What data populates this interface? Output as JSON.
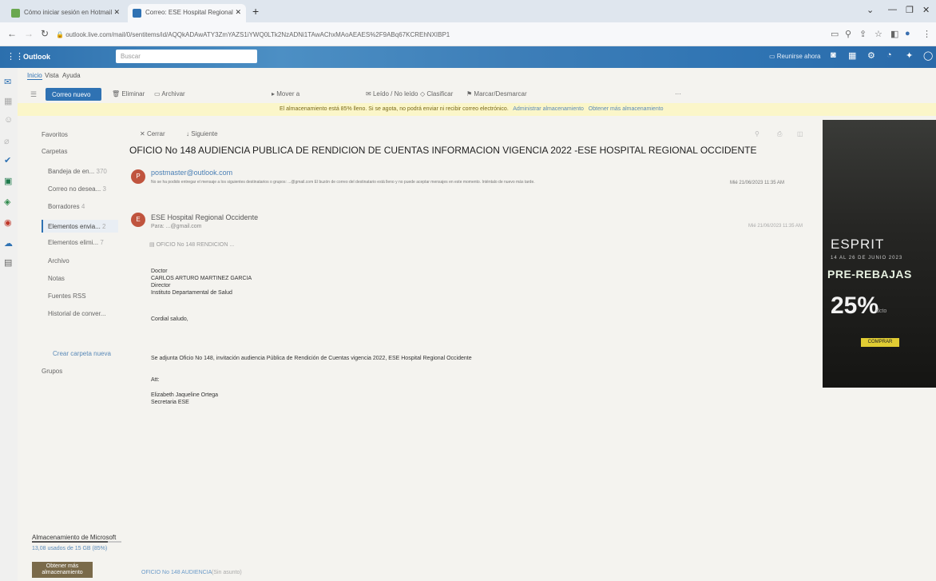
{
  "browser": {
    "tabs": [
      {
        "label": "Cómo iniciar sesión en Hotmail"
      },
      {
        "label": "Correo: ESE Hospital Regional"
      }
    ],
    "new_tab": "+",
    "url": "outlook.live.com/mail/0/sentitems/id/AQQkADAwATY3ZmYAZS1iYWQ0LTk2NzADNi1TAwAChxMAoAEAES%2F9ABq67KCREhNXIBP1"
  },
  "outlook": {
    "brand": "Outlook",
    "search_placeholder": "Buscar",
    "meet_now": "Reunirse ahora"
  },
  "menu_tabs": [
    "Inicio",
    "Vista",
    "Ayuda"
  ],
  "commands": {
    "new_mail": "Correo nuevo",
    "delete": "Eliminar",
    "archive": "Archivar",
    "move": "Mover a",
    "read_unread": "Leído / No leído",
    "categorize": "Clasificar",
    "flag": "Marcar/Desmarcar"
  },
  "warning": {
    "text": "El almacenamiento está 85% lleno. Si se agota, no podrá enviar ni recibir correo electrónico.",
    "link1": "Administrar almacenamiento",
    "link2": "Obtener más almacenamiento"
  },
  "folders": {
    "favorites": "Favoritos",
    "folders_header": "Carpetas",
    "items": [
      {
        "label": "Bandeja de en...",
        "count": "370"
      },
      {
        "label": "Correo no desea...",
        "count": "3"
      },
      {
        "label": "Borradores",
        "count": "4"
      },
      {
        "label": "Elementos envia...",
        "count": "2"
      },
      {
        "label": "Elementos elimi...",
        "count": "7"
      },
      {
        "label": "Archivo",
        "count": ""
      },
      {
        "label": "Notas",
        "count": ""
      },
      {
        "label": "Fuentes RSS",
        "count": ""
      },
      {
        "label": "Historial de conver...",
        "count": ""
      }
    ],
    "new_folder": "Crear carpeta nueva",
    "groups": "Grupos"
  },
  "reading": {
    "close": "Cerrar",
    "next": "Siguiente",
    "subject": "OFICIO No 148 AUDIENCIA PUBLICA DE RENDICION DE CUENTAS INFORMACION VIGENCIA 2022 -ESE HOSPITAL REGIONAL OCCIDENTE",
    "ndr": {
      "avatar": "P",
      "from": "postmaster@outlook.com",
      "preview": "No se ha podido entregar el mensaje a los siguientes destinatarios o grupos: ...@gmail.com El buzón de correo del destinatario está lleno y no puede aceptar mensajes en este momento. Inténtalo de nuevo más tarde.",
      "date": "Mié 21/06/2023 11:35 AM"
    },
    "message": {
      "avatar": "E",
      "from": "ESE Hospital Regional Occidente",
      "to": "Para: ...@gmail.com",
      "date": "Mié 21/06/2023 11:35 AM",
      "attachment": "OFICIO No 148 RENDICION ...",
      "body": [
        "Doctor",
        "CARLOS ARTURO MARTINEZ GARCIA",
        "Director",
        "Instituto Departamental de Salud",
        "Cordial saludo,",
        "Se adjunta Oficio No 148, invitación audiencia Pública de Rendición de Cuentas vigencia 2022, ESE Hospital Regional Occidente",
        "Att:",
        "Elizabeth Jaqueline Ortega",
        "Secretaria ESE"
      ]
    }
  },
  "ad": {
    "brand": "ESPRIT",
    "date": "14 AL 26 DE JUNIO 2023",
    "title": "PRE-REBAJAS",
    "percent": "25%",
    "percent_sub": "dcto",
    "button": "COMPRAR"
  },
  "storage": {
    "title": "Almacenamiento de Microsoft",
    "used": "13,08 usados de 15 GB (85%)",
    "fill_fraction": 0.85,
    "get_more": "Obtener más almacenamiento"
  },
  "bottom": {
    "draft_tab": "OFICIO No 148 AUDIENCIA",
    "draft_label": "(Sin asunto)"
  }
}
